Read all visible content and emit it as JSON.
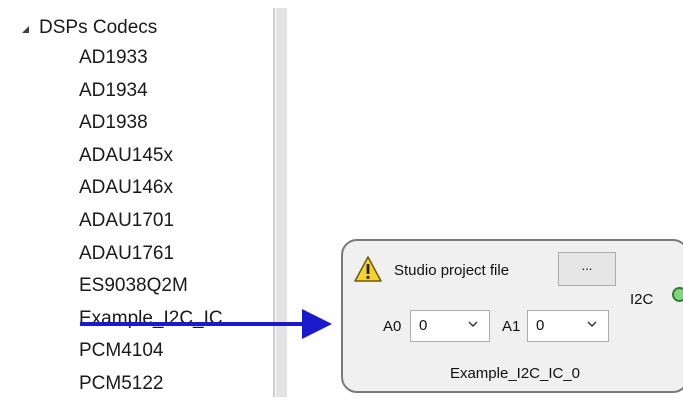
{
  "tree": {
    "header_label": "DSPs Codecs",
    "items": [
      {
        "label": "AD1933"
      },
      {
        "label": "AD1934"
      },
      {
        "label": "AD1938"
      },
      {
        "label": "ADAU145x"
      },
      {
        "label": "ADAU146x"
      },
      {
        "label": "ADAU1701"
      },
      {
        "label": "ADAU1761"
      },
      {
        "label": "ES9038Q2M"
      },
      {
        "label": "Example_I2C_IC"
      },
      {
        "label": "PCM4104"
      },
      {
        "label": "PCM5122"
      }
    ]
  },
  "block": {
    "warning_icon": "warning-icon",
    "studio_label": "Studio project file",
    "browse_label": "...",
    "a0_label": "A0",
    "a0_value": "0",
    "a1_label": "A1",
    "a1_value": "0",
    "name": "Example_I2C_IC_0",
    "port_label": "I2C",
    "port_color": "#7dd87d"
  },
  "colors": {
    "arrow": "#1a1acc",
    "block_border": "#7a7a7a",
    "block_fill": "#f0f0f0",
    "warning_fill": "#f5d230"
  }
}
